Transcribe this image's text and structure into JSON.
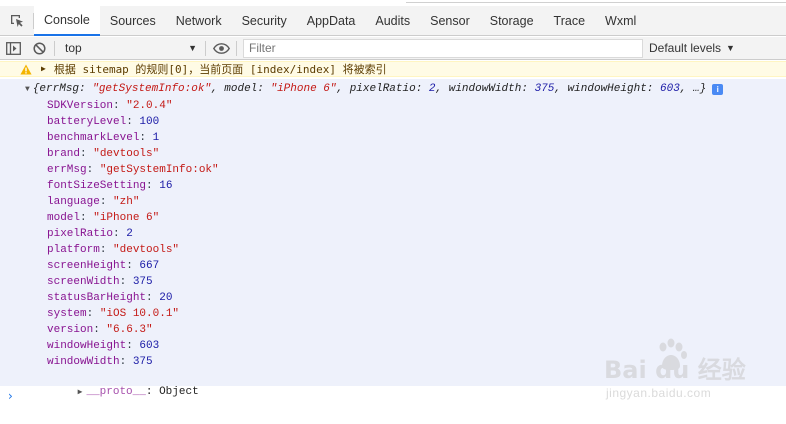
{
  "tabs": [
    {
      "label": "Console",
      "active": true
    },
    {
      "label": "Sources",
      "active": false
    },
    {
      "label": "Network",
      "active": false
    },
    {
      "label": "Security",
      "active": false
    },
    {
      "label": "AppData",
      "active": false
    },
    {
      "label": "Audits",
      "active": false
    },
    {
      "label": "Sensor",
      "active": false
    },
    {
      "label": "Storage",
      "active": false
    },
    {
      "label": "Trace",
      "active": false
    },
    {
      "label": "Wxml",
      "active": false
    }
  ],
  "toolbar": {
    "context": "top",
    "filter_placeholder": "Filter",
    "levels_label": "Default levels"
  },
  "console": {
    "warning_text": "根据 sitemap 的规则[0]，当前页面 [index/index] 将被索引",
    "summary": {
      "open": "{",
      "k1": "errMsg",
      "v1": "\"getSystemInfo:ok\"",
      "k2": "model",
      "v2": "\"iPhone 6\"",
      "k3": "pixelRatio",
      "v3": "2",
      "k4": "windowWidth",
      "v4": "375",
      "k5": "windowHeight",
      "v5": "603",
      "tail": ", …}"
    },
    "properties": [
      {
        "key": "SDKVersion",
        "value": "\"2.0.4\"",
        "type": "string"
      },
      {
        "key": "batteryLevel",
        "value": "100",
        "type": "number"
      },
      {
        "key": "benchmarkLevel",
        "value": "1",
        "type": "number"
      },
      {
        "key": "brand",
        "value": "\"devtools\"",
        "type": "string"
      },
      {
        "key": "errMsg",
        "value": "\"getSystemInfo:ok\"",
        "type": "string"
      },
      {
        "key": "fontSizeSetting",
        "value": "16",
        "type": "number"
      },
      {
        "key": "language",
        "value": "\"zh\"",
        "type": "string"
      },
      {
        "key": "model",
        "value": "\"iPhone 6\"",
        "type": "string"
      },
      {
        "key": "pixelRatio",
        "value": "2",
        "type": "number"
      },
      {
        "key": "platform",
        "value": "\"devtools\"",
        "type": "string"
      },
      {
        "key": "screenHeight",
        "value": "667",
        "type": "number"
      },
      {
        "key": "screenWidth",
        "value": "375",
        "type": "number"
      },
      {
        "key": "statusBarHeight",
        "value": "20",
        "type": "number"
      },
      {
        "key": "system",
        "value": "\"iOS 10.0.1\"",
        "type": "string"
      },
      {
        "key": "version",
        "value": "\"6.6.3\"",
        "type": "string"
      },
      {
        "key": "windowHeight",
        "value": "603",
        "type": "number"
      },
      {
        "key": "windowWidth",
        "value": "375",
        "type": "number"
      }
    ],
    "proto": {
      "key": "__proto__",
      "value": "Object"
    },
    "prompt": "›"
  },
  "watermark": {
    "logo": "Bai  du 经验",
    "url": "jingyan.baidu.com"
  },
  "icons": {
    "inspect": "inspect-element-icon",
    "sidebar": "sidebar-toggle-icon",
    "clear": "clear-console-icon",
    "eye": "live-expression-icon",
    "warning": "warning-icon",
    "info": "info-icon"
  },
  "colors": {
    "active_tab_underline": "#1a73e8",
    "warning_bg": "#fffbe5",
    "object_bg": "#eef1fb",
    "string_value": "#c41a16",
    "number_value": "#1a1aa6",
    "property_key": "#881391"
  }
}
